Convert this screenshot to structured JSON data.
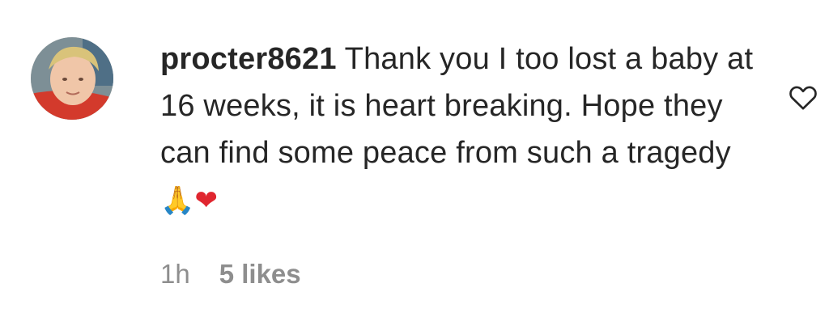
{
  "comment": {
    "username": "procter8621",
    "text": "Thank you I too lost a baby at 16 weeks, it is heart breaking. Hope they can find some peace from such a tragedy",
    "emojis": [
      "🙏",
      "❤"
    ],
    "timestamp": "1h",
    "likes": "5 likes",
    "avatar_icon": "user-avatar-photo",
    "like_icon": "heart-outline-icon"
  },
  "colors": {
    "text": "#262626",
    "meta": "#8e8e8e"
  }
}
